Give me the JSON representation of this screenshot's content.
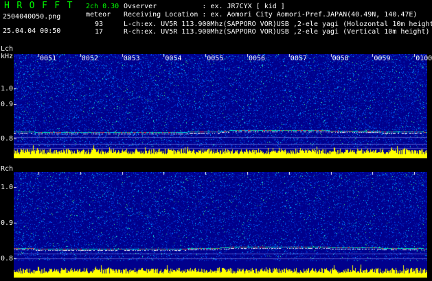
{
  "header": {
    "logo": "HROFFT",
    "filename": "2504040050.png",
    "datetime": "25.04.04 00:50",
    "version": "2ch 0.30",
    "meteor_label": "meteor",
    "count_l": "93",
    "count_r": "17",
    "observer": "Ovserver           : ex. JR7CYX [ kid ]",
    "location": "Receiving Location : ex. Aomori City Aomori-Pref.JAPAN(40.49N, 140.47E)",
    "lch_info": "L-ch:ex. UV5R 113.900Mhz(SAPPORO VOR)USB ,2-ele yagi (Holozontal 10m height)",
    "rch_info": "R-ch:ex. UV5R 113.900Mhz(SAPPORO VOR)USB ,2-ele yagi (Vertical 10m height)"
  },
  "lch": {
    "label": "Lch",
    "unit": "kHz",
    "yticks": [
      "1.0",
      "0.9",
      "0.8"
    ],
    "time_labels": [
      "0051",
      "0052",
      "0053",
      "0054",
      "0055",
      "0056",
      "0057",
      "0058",
      "0059",
      "0100"
    ]
  },
  "rch": {
    "label": "Rch",
    "yticks": [
      "1.0",
      "0.9",
      "0.8"
    ]
  },
  "colors": {
    "background": "#000000",
    "waterfall_base": "#00008c",
    "level_fill": "#ffff00",
    "level_base": "#00ffff",
    "logo_green": "#00ff00"
  }
}
